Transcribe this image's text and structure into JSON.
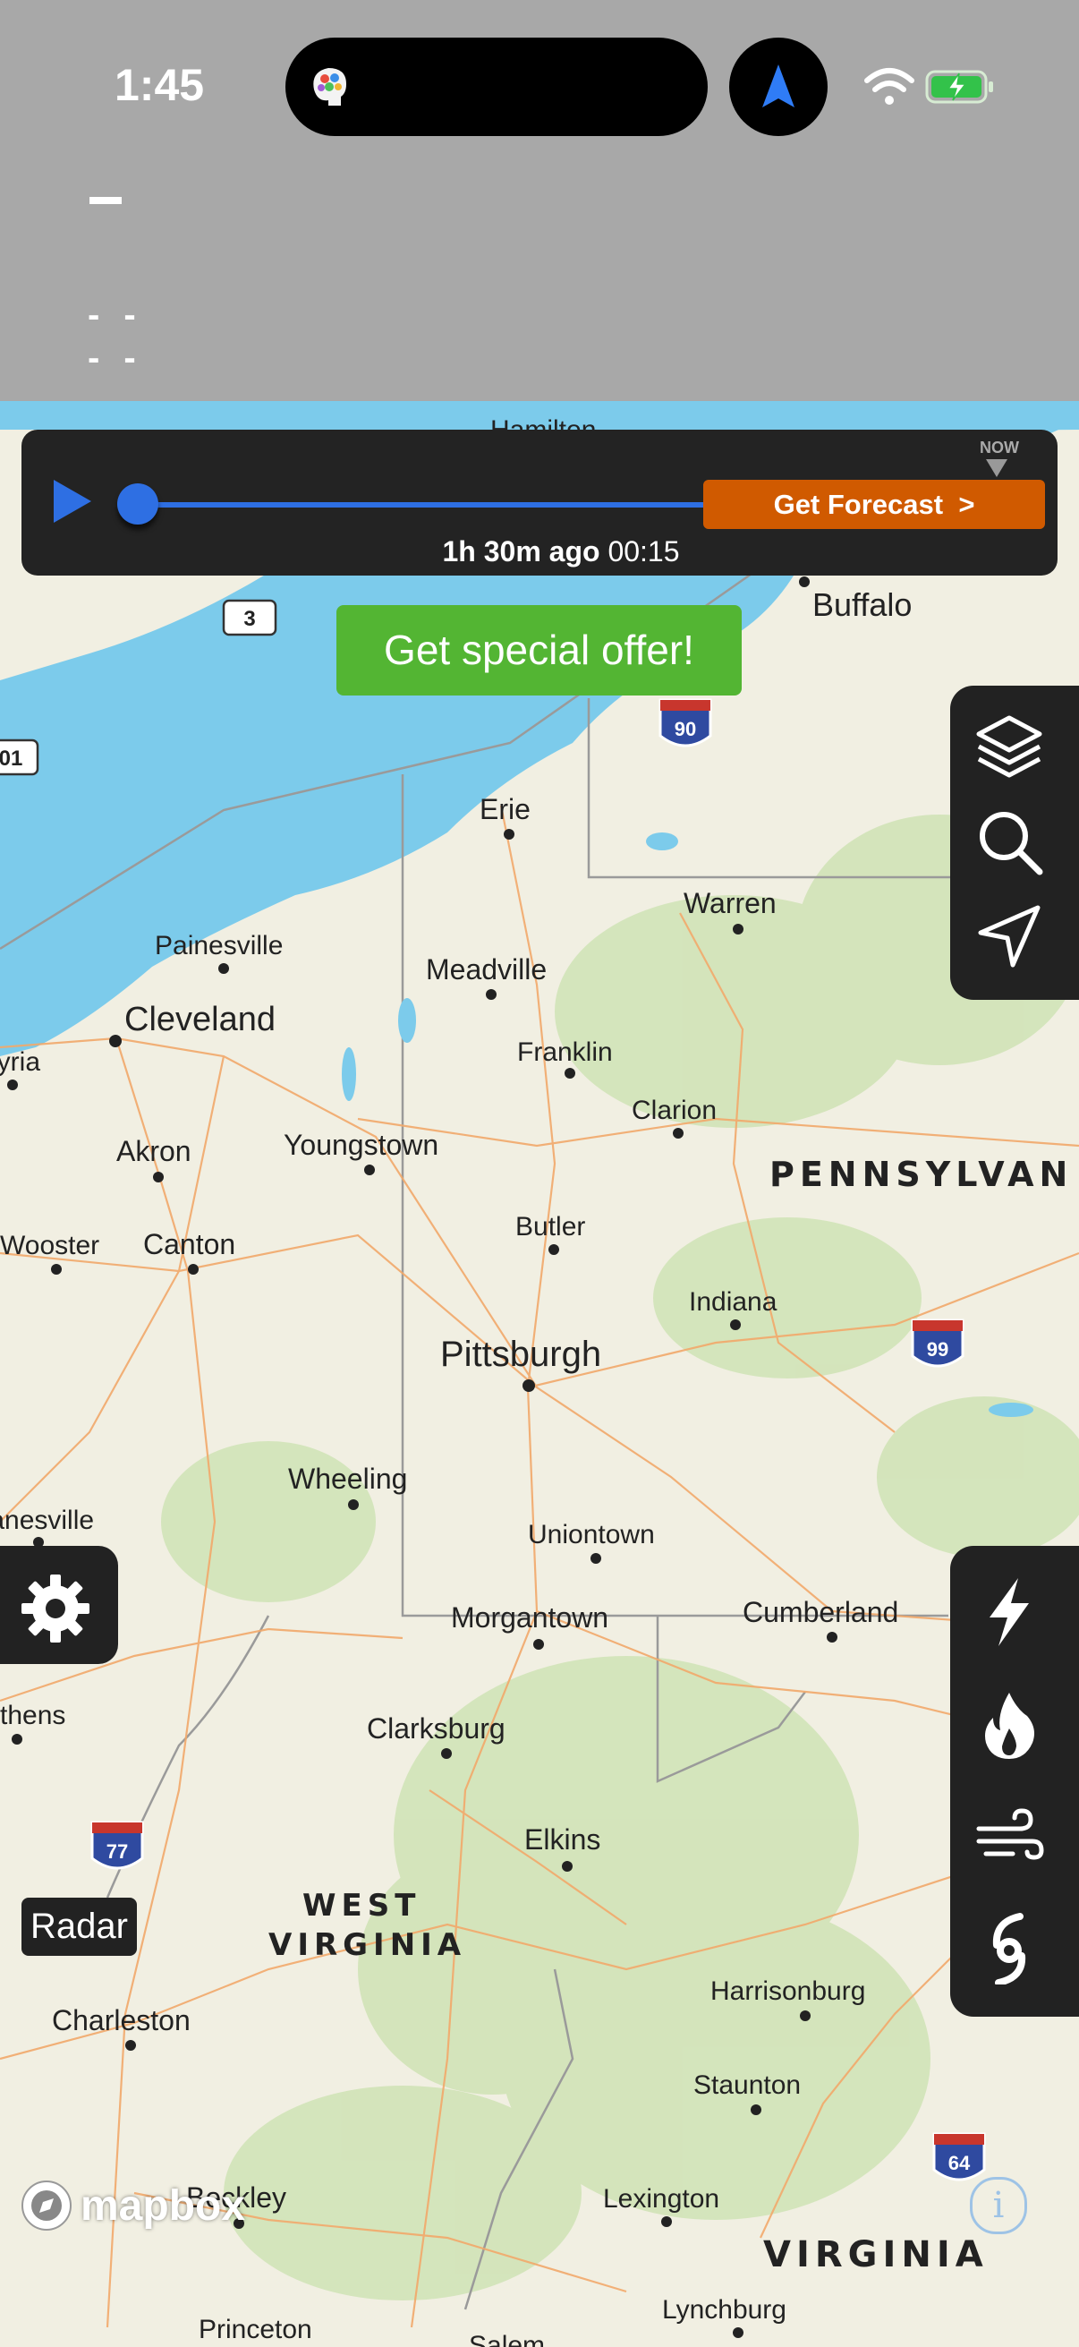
{
  "status_bar": {
    "time": "1:45"
  },
  "header": {
    "line1": "- -",
    "line2": "- -"
  },
  "timeline": {
    "forecast_button": "Get Forecast  >",
    "now_label": "NOW",
    "time_ago": "1h 30m ago",
    "clock": "00:15",
    "progress": 0.0
  },
  "offer": {
    "label": "Get special offer!"
  },
  "map": {
    "cities": [
      "Buffalo",
      "Erie",
      "Warren",
      "Painesville",
      "Meadville",
      "Cleveland",
      "Franklin",
      "Clarion",
      "Elyria",
      "Akron",
      "Youngstown",
      "Wooster",
      "Canton",
      "Butler",
      "Indiana",
      "Pittsburgh",
      "Wheeling",
      "Zanesville",
      "Uniontown",
      "Morgantown",
      "Cumberland",
      "Athens",
      "Clarksburg",
      "Elkins",
      "Harrisonburg",
      "Charleston",
      "Staunton",
      "Beckley",
      "Lexington",
      "Lynchburg",
      "Princeton",
      "Salem",
      "Hamilton"
    ],
    "states": [
      "PENNSYLVAN",
      "WEST",
      "VIRGINIA",
      "VIRGINIA"
    ],
    "shields": [
      "90",
      "99",
      "77",
      "64",
      "3",
      "01"
    ]
  },
  "layer_label": "Radar",
  "attribution": "mapbox",
  "colors": {
    "header": "#a8a8a8",
    "panel": "#222222",
    "accent_blue": "#2e6fe3",
    "forecast_orange": "#d05a00",
    "offer_green": "#53b533",
    "water": "#7ccbeb",
    "land": "#f1efe2"
  },
  "icons": {
    "top_tools": [
      "layers-icon",
      "search-icon",
      "location-arrow-icon"
    ],
    "bottom_tools": [
      "lightning-icon",
      "fire-icon",
      "wind-icon",
      "hurricane-icon"
    ]
  }
}
